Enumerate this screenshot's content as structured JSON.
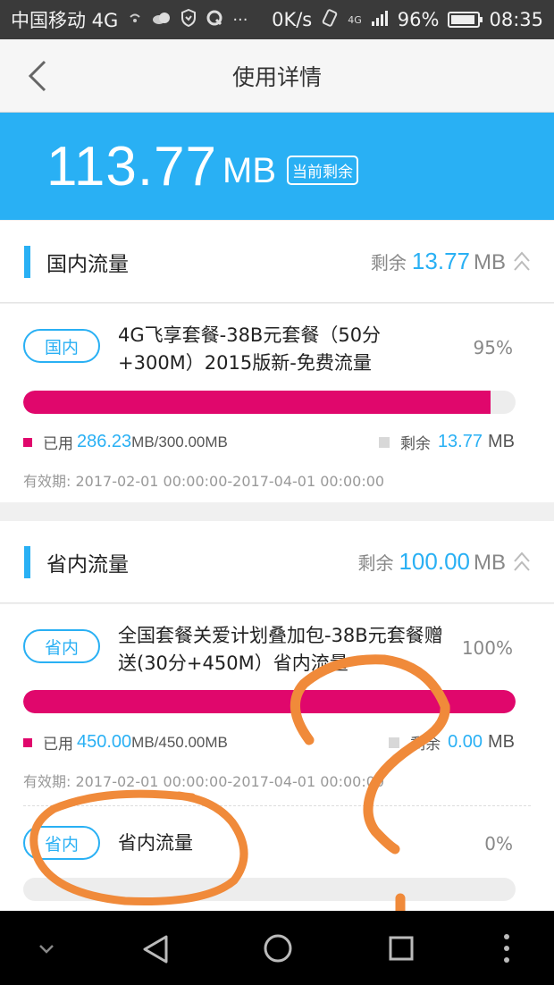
{
  "status_bar": {
    "carrier": "中国移动 4G",
    "speed": "0K/s",
    "network": "4G",
    "battery": "96%",
    "time": "08:35"
  },
  "header": {
    "title": "使用详情"
  },
  "summary": {
    "amount": "113.77",
    "unit": "MB",
    "badge": "当前剩余"
  },
  "sections": [
    {
      "title": "国内流量",
      "remain_label": "剩余",
      "remain_value": "13.77",
      "remain_unit": "MB",
      "packages": [
        {
          "tag": "国内",
          "name": "4G飞享套餐-38B元套餐（50分+300M）2015版新-免费流量",
          "percent": "95%",
          "fill": 0.95,
          "used_label": "已用",
          "used_value": "286.23",
          "used_total": "MB/300.00MB",
          "remain_label": "剩余",
          "remain_value": "13.77",
          "remain_unit": "MB",
          "validity": "有效期:   2017-02-01 00:00:00-2017-04-01 00:00:00"
        }
      ]
    },
    {
      "title": "省内流量",
      "remain_label": "剩余",
      "remain_value": "100.00",
      "remain_unit": "MB",
      "packages": [
        {
          "tag": "省内",
          "name": "全国套餐关爱计划叠加包-38B元套餐赠送(30分+450M）省内流量",
          "percent": "100%",
          "fill": 1.0,
          "used_label": "已用",
          "used_value": "450.00",
          "used_total": "MB/450.00MB",
          "remain_label": "剩余",
          "remain_value": "0.00",
          "remain_unit": "MB",
          "validity": "有效期:   2017-02-01 00:00:00-2017-04-01 00:00:00"
        },
        {
          "tag": "省内",
          "name": "省内流量",
          "percent": "0%",
          "fill": 0.0
        }
      ]
    }
  ],
  "colors": {
    "accent": "#29b0f4",
    "bar_fill": "#e0076c",
    "scribble": "#f08a3a"
  },
  "nav_icons": [
    "chevron-down-icon",
    "back-triangle-icon",
    "home-circle-icon",
    "recents-square-icon",
    "more-dots-icon"
  ]
}
